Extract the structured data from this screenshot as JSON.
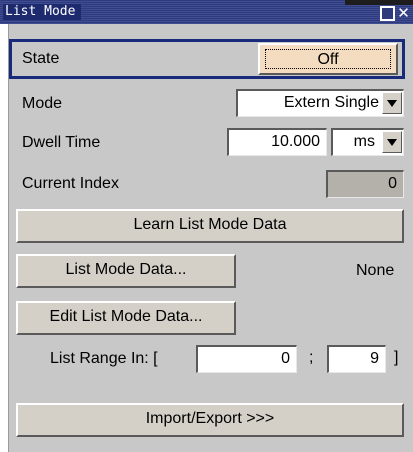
{
  "window": {
    "title": "List Mode"
  },
  "state": {
    "label": "State",
    "value": "Off"
  },
  "mode": {
    "label": "Mode",
    "value": "Extern Single"
  },
  "dwell_time": {
    "label": "Dwell Time",
    "value": "10.000",
    "unit": "ms"
  },
  "current_index": {
    "label": "Current Index",
    "value": "0"
  },
  "buttons": {
    "learn": "Learn List Mode Data",
    "list_mode_data": "List Mode Data...",
    "edit_list_mode_data": "Edit List Mode Data...",
    "import_export": "Import/Export >>>"
  },
  "list_mode_data_value": "None",
  "list_range": {
    "label": "List Range In: [",
    "start": "0",
    "separator": ";",
    "end": "9",
    "close": "]"
  }
}
